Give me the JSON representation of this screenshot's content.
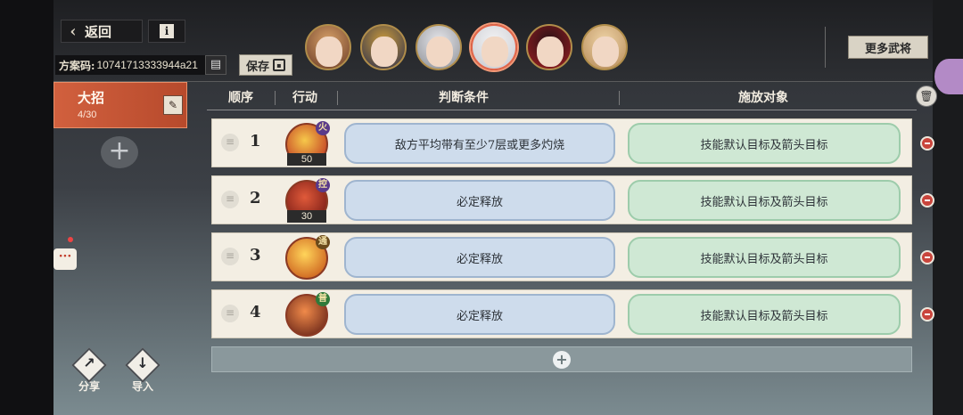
{
  "header": {
    "back_label": "返回",
    "info_label": "i",
    "plan_code_label": "方案码:",
    "plan_code_value": "10741713333944a21",
    "save_label": "保存",
    "more_generals_label": "更多武将"
  },
  "avatars": [
    {
      "name": "general-1",
      "colors": [
        "#6a3b26",
        "#d6a068"
      ]
    },
    {
      "name": "general-2",
      "colors": [
        "#2b2e4c",
        "#c99a3c"
      ]
    },
    {
      "name": "general-3",
      "colors": [
        "#8c8f96",
        "#e6e6ea"
      ]
    },
    {
      "name": "general-4",
      "colors": [
        "#c7c9cf",
        "#f2f2f4"
      ],
      "selected": true
    },
    {
      "name": "general-5",
      "colors": [
        "#9c1e22",
        "#2a1216"
      ]
    },
    {
      "name": "general-6",
      "colors": [
        "#b68a58",
        "#eed3a6"
      ]
    }
  ],
  "sidebar": {
    "tab_title": "大招",
    "tab_count": "4/30"
  },
  "columns": {
    "order": "顺序",
    "action": "行动",
    "condition": "判断条件",
    "target": "施放对象"
  },
  "rows": [
    {
      "order": "1",
      "badge": "50",
      "tag": "火",
      "condition": "敌方平均带有至少7层或更多灼烧",
      "target": "技能默认目标及箭头目标",
      "skill_colors": [
        "#f6c84a",
        "#b8231c"
      ]
    },
    {
      "order": "2",
      "badge": "30",
      "tag": "控",
      "condition": "必定释放",
      "target": "技能默认目标及箭头目标",
      "skill_colors": [
        "#e05a3a",
        "#6a1210"
      ]
    },
    {
      "order": "3",
      "badge": "",
      "tag": "通",
      "condition": "必定释放",
      "target": "技能默认目标及箭头目标",
      "skill_colors": [
        "#ffd45a",
        "#c24a12"
      ]
    },
    {
      "order": "4",
      "badge": "",
      "tag": "普",
      "condition": "必定释放",
      "target": "技能默认目标及箭头目标",
      "skill_colors": [
        "#f08a4a",
        "#5a1a12"
      ]
    }
  ],
  "bottom": {
    "share_label": "分享",
    "import_label": "导入"
  },
  "colors": {
    "accent": "#c9553a",
    "condition_bg": "#cedcec",
    "target_bg": "#cfe8d4",
    "remove": "#c9453c"
  }
}
